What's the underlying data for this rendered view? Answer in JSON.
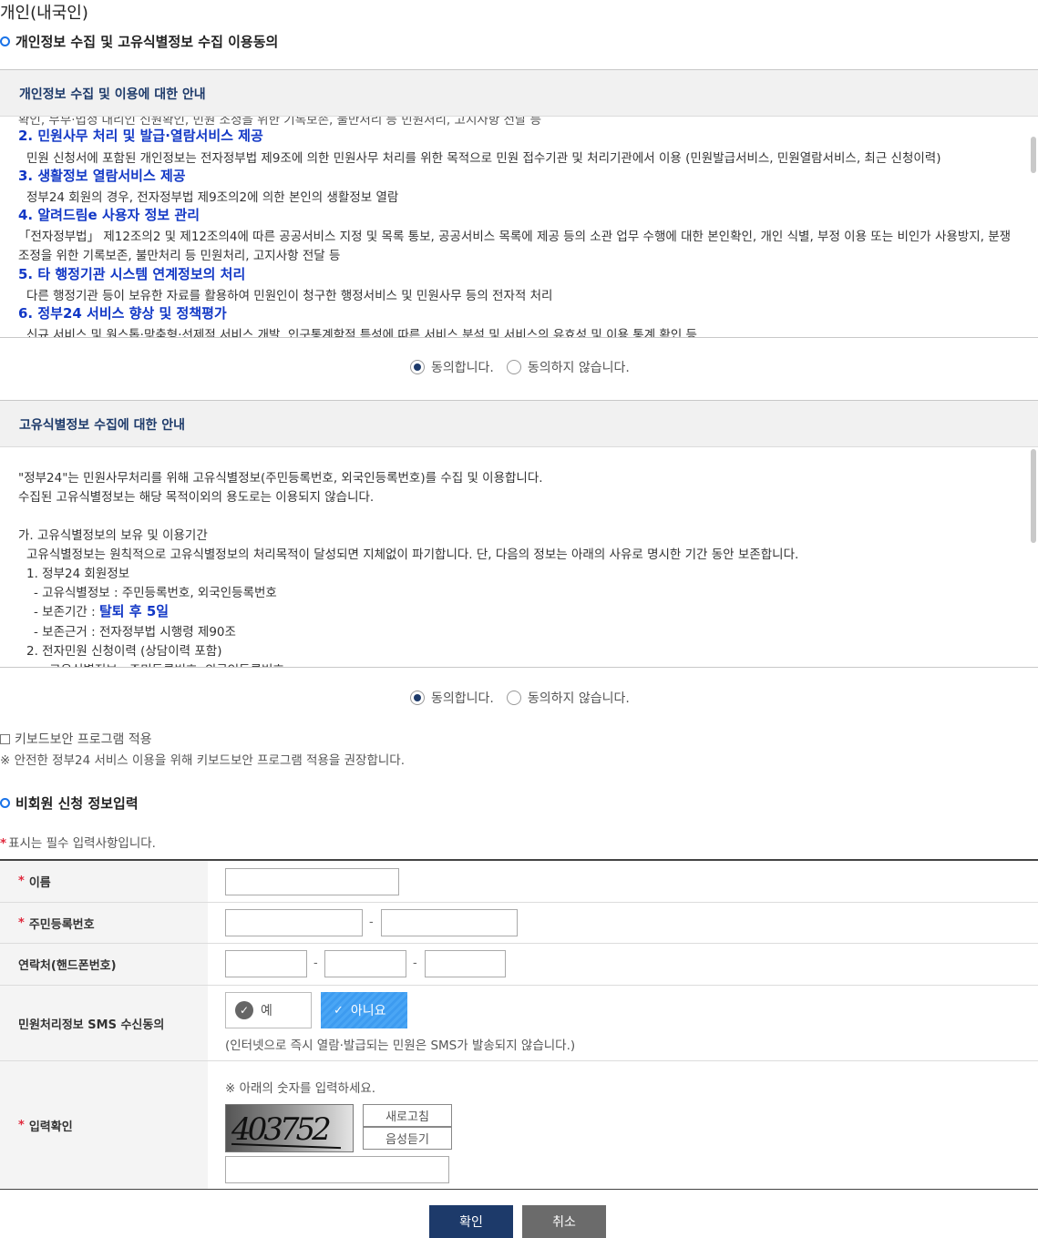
{
  "page_title": "개인(내국인)",
  "consent_section_title": "개인정보 수집 및 고유식별정보 수집 이용동의",
  "privacy_box": {
    "title": "개인정보 수집 및 이용에 대한 안내",
    "cut_top_line": "확인, 무부·법정 대리인 신원확인, 민원 조정을 위한 기록보존, 불만처리 등 민원처리, 고지사항 전달 등",
    "items": [
      {
        "head": "2. 민원사무 처리 및 발급·열람서비스 제공",
        "body": [
          "민원 신청서에 포함된 개인정보는 전자정부법 제9조에 의한 민원사무 처리를 위한 목적으로 민원 접수기관 및 처리기관에서 이용 (민원발급서비스, 민원열람서비스, 최근 신청이력)"
        ]
      },
      {
        "head": "3. 생활정보 열람서비스 제공",
        "body": [
          "정부24 회원의 경우, 전자정부법 제9조의2에 의한 본인의 생활정보 열람"
        ]
      },
      {
        "head": "4. 알려드림e 사용자 정보 관리",
        "body": [
          "「전자정부법」 제12조의2 및 제12조의4에 따른 공공서비스 지정 및 목록 통보, 공공서비스 목록에 제공 등의 소관 업무 수행에 대한 본인확인, 개인 식별, 부정 이용 또는 비인가 사용방지, 분쟁",
          "조정을 위한 기록보존, 불만처리 등 민원처리, 고지사항 전달 등"
        ]
      },
      {
        "head": "5. 타 행정기관 시스템 연계정보의 처리",
        "body": [
          "다른 행정기관 등이 보유한 자료를 활용하여 민원인이 청구한 행정서비스 및 민원사무 등의 전자적 처리"
        ]
      },
      {
        "head": "6. 정부24 서비스 향상 및 정책평가",
        "body": [
          "신규 서비스 및 원스톱·맞춤형·선제적 서비스 개발, 인구통계학적 특성에 따른 서비스 분석 및 서비스의 유효성 및 이용 통계 확인 등"
        ]
      }
    ]
  },
  "agree_label": "동의합니다.",
  "disagree_label": "동의하지 않습니다.",
  "unique_box": {
    "title": "고유식별정보 수집에 대한 안내",
    "line1": "\"정부24\"는 민원사무처리를 위해 고유식별정보(주민등록번호, 외국인등록번호)를 수집 및 이용합니다.",
    "line2": "수집된 고유식별정보는 해당 목적이외의 용도로는 이용되지 않습니다.",
    "line3": "가. 고유식별정보의 보유 및 이용기간",
    "line4": "고유식별정보는 원칙적으로 고유식별정보의 처리목적이 달성되면 지체없이 파기합니다. 단, 다음의 정보는 아래의 사유로 명시한 기간 동안 보존합니다.",
    "line5": "1. 정부24 회원정보",
    "line6": "- 고유식별정보 : 주민등록번호, 외국인등록번호",
    "line7_prefix": "- 보존기간 : ",
    "line7_value": "탈퇴 후 5일",
    "line8": "- 보존근거 : 전자정부법 시행령 제90조",
    "line9": "2. 전자민원 신청이력 (상담이력 포함)",
    "line10": "- 고유식별정보 : 주민등록번호, 외국인등록번호"
  },
  "keyboard_security": {
    "label": "키보드보안 프로그램 적용",
    "note": "※ 안전한 정부24 서비스 이용을 위해 키보드보안 프로그램 적용을 권장합니다."
  },
  "nonmember_section_title": "비회원 신청 정보입력",
  "required_note": "표시는 필수 입력사항입니다.",
  "required_mark": "*",
  "form": {
    "name_label": "이름",
    "rrn_label": "주민등록번호",
    "phone_label": "연락처(핸드폰번호)",
    "sms_label": "민원처리정보 SMS 수신동의",
    "sms_yes": "예",
    "sms_no": "아니요",
    "sms_note": "(인터넷으로 즉시 열람·발급되는 민원은 SMS가 발송되지 않습니다.)",
    "captcha_label": "입력확인",
    "captcha_instruction": "※ 아래의 숫자를 입력하세요.",
    "captcha_text": "403752",
    "refresh_button": "새로고침",
    "audio_button": "음성듣기",
    "dash": "-"
  },
  "buttons": {
    "confirm": "확인",
    "cancel": "취소"
  },
  "colors": {
    "navy": "#1d3a6a",
    "blue_heading": "#1238c6",
    "required": "#e0283c",
    "sms_selected": "#3d9bf0"
  }
}
